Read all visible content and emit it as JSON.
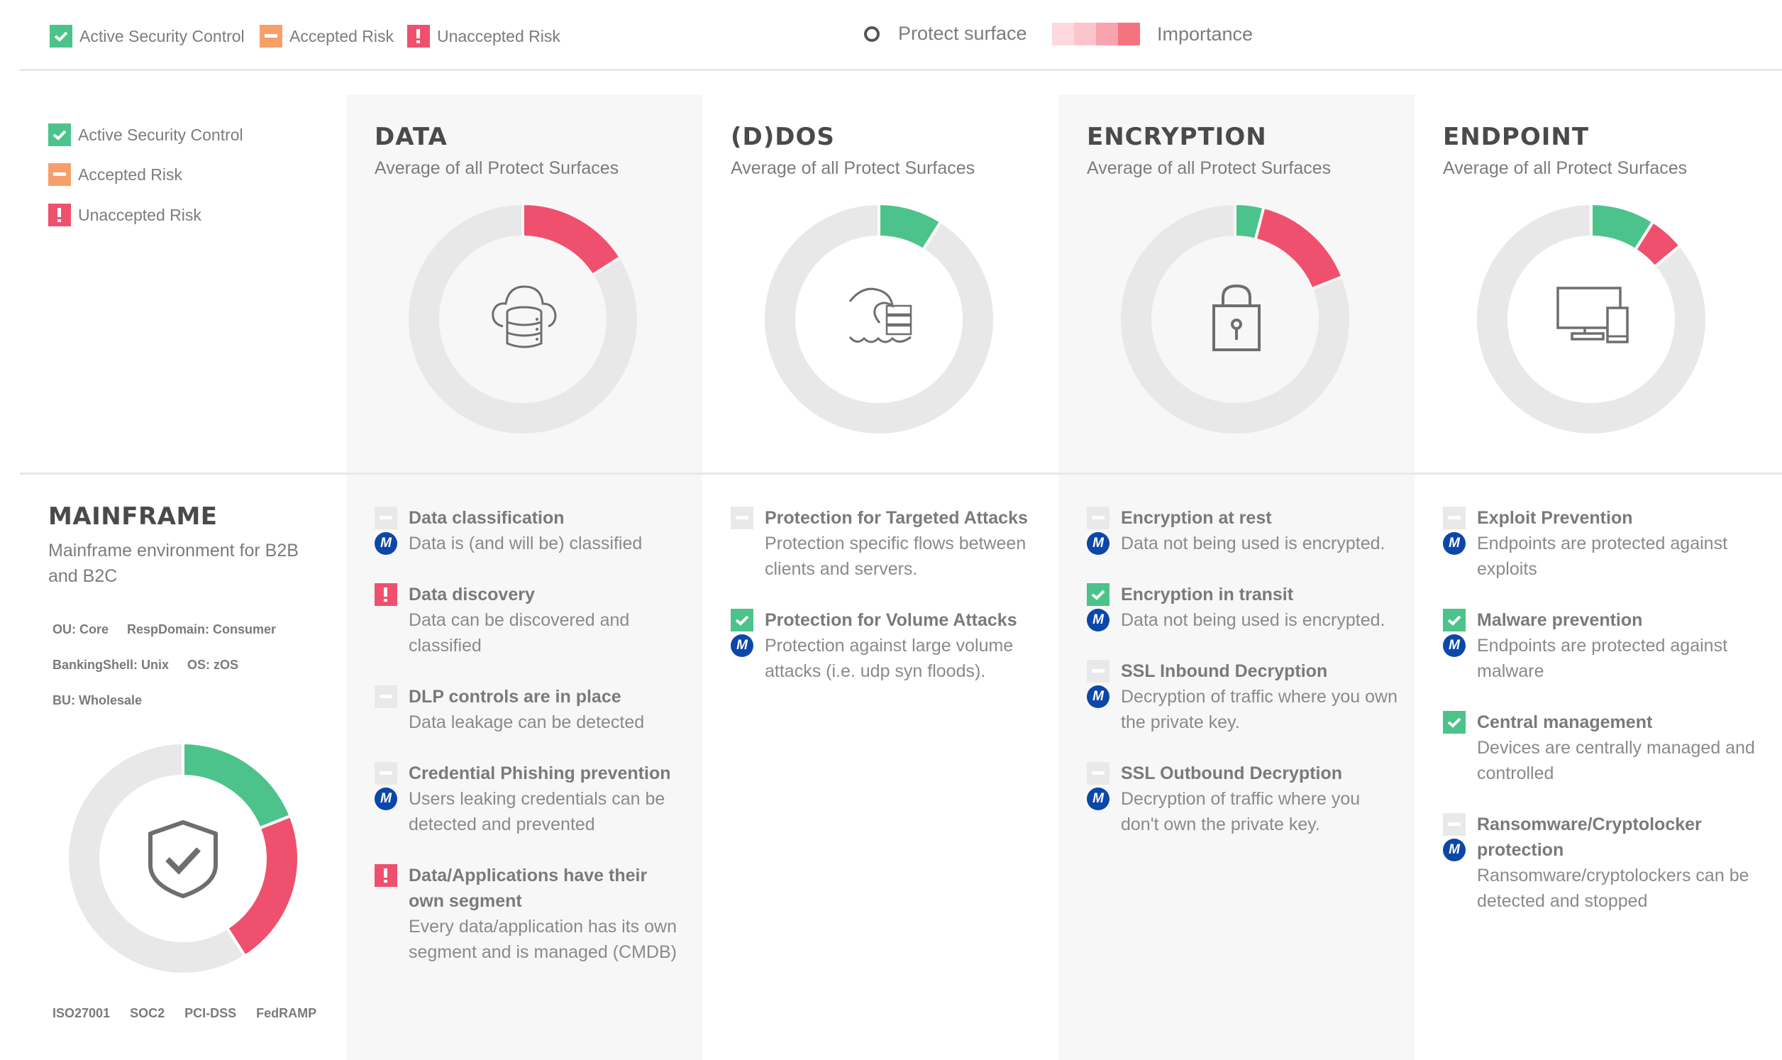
{
  "colors": {
    "green": "#4cc38a",
    "orange": "#f5a06a",
    "red": "#ef506e",
    "gray_track": "#e8e8e8",
    "m_badge": "#0b47a8",
    "importance_scale": [
      "#fdd9de",
      "#fcc4cc",
      "#f9a3ae",
      "#f5737f"
    ]
  },
  "header": {
    "legend": [
      {
        "icon": "check-icon",
        "status": "active",
        "label": "Active Security Control"
      },
      {
        "icon": "minus-icon",
        "status": "accepted",
        "label": "Accepted Risk"
      },
      {
        "icon": "exclamation-icon",
        "status": "unaccepted",
        "label": "Unaccepted Risk"
      }
    ],
    "protect_surface_label": "Protect surface",
    "importance_label": "Importance"
  },
  "side_legend": [
    {
      "icon": "check-icon",
      "status": "active",
      "label": "Active Security Control"
    },
    {
      "icon": "minus-icon",
      "status": "accepted",
      "label": "Accepted Risk"
    },
    {
      "icon": "exclamation-icon",
      "status": "unaccepted",
      "label": "Unaccepted Risk"
    }
  ],
  "mainframe": {
    "title": "MAINFRAME",
    "description": "Mainframe environment for B2B and B2C",
    "tags": [
      "OU: Core",
      "RespDomain: Consumer",
      "BankingShell: Unix",
      "OS: zOS",
      "BU: Wholesale"
    ],
    "certifications": [
      "ISO27001",
      "SOC2",
      "PCI-DSS",
      "FedRAMP"
    ],
    "icon": "shield-check-icon"
  },
  "columns": [
    {
      "title": "DATA",
      "subtitle": "Average of all Protect Surfaces",
      "icon": "cloud-database-icon",
      "controls": [
        {
          "status": "neutral",
          "title": "Data classification",
          "desc": "Data is (and will be) classified",
          "managed": true
        },
        {
          "status": "unaccepted",
          "title": "Data discovery",
          "desc": "Data can be discovered and classified",
          "managed": false
        },
        {
          "status": "neutral",
          "title": "DLP controls are in place",
          "desc": "Data leakage can be detected",
          "managed": false
        },
        {
          "status": "neutral",
          "title": "Credential Phishing prevention",
          "desc": "Users leaking credentials can be detected and prevented",
          "managed": true
        },
        {
          "status": "unaccepted",
          "title": "Data/Applications have their own segment",
          "desc": "Every data/application has its own segment and is managed (CMDB)",
          "managed": false
        }
      ]
    },
    {
      "title": "(D)DOS",
      "subtitle": "Average of all Protect Surfaces",
      "icon": "wave-server-icon",
      "controls": [
        {
          "status": "neutral",
          "title": "Protection for Targeted Attacks",
          "desc": "Protection specific flows between clients and servers.",
          "managed": false
        },
        {
          "status": "active",
          "title": "Protection for Volume Attacks",
          "desc": "Protection against large volume attacks (i.e. udp syn floods).",
          "managed": true
        }
      ]
    },
    {
      "title": "ENCRYPTION",
      "subtitle": "Average of all Protect Surfaces",
      "icon": "padlock-icon",
      "controls": [
        {
          "status": "neutral",
          "title": "Encryption at rest",
          "desc": "Data not being used is encrypted.",
          "managed": true
        },
        {
          "status": "active",
          "title": "Encryption in transit",
          "desc": "Data not being used is encrypted.",
          "managed": true
        },
        {
          "status": "neutral",
          "title": "SSL Inbound Decryption",
          "desc": "Decryption of traffic where you own the private key.",
          "managed": true
        },
        {
          "status": "neutral",
          "title": "SSL Outbound Decryption",
          "desc": "Decryption of traffic where you don't own the private key.",
          "managed": true
        }
      ]
    },
    {
      "title": "ENDPOINT",
      "subtitle": "Average of all Protect Surfaces",
      "icon": "devices-icon",
      "controls": [
        {
          "status": "neutral",
          "title": "Exploit Prevention",
          "desc": "Endpoints are protected against exploits",
          "managed": true
        },
        {
          "status": "active",
          "title": "Malware prevention",
          "desc": "Endpoints are protected against malware",
          "managed": true
        },
        {
          "status": "active",
          "title": "Central management",
          "desc": "Devices are centrally managed and controlled",
          "managed": false
        },
        {
          "status": "neutral",
          "title": "Ransomware/Cryptolocker protection",
          "desc": "Ransomware/cryptolockers can be detected and stopped",
          "managed": true
        }
      ]
    }
  ],
  "chart_data": [
    {
      "type": "pie",
      "title": "DATA",
      "subtitle": "Average of all Protect Surfaces",
      "segments": [
        {
          "name": "Unaccepted Risk",
          "value": 0.16
        },
        {
          "name": "Remaining",
          "value": 0.84
        }
      ]
    },
    {
      "type": "pie",
      "title": "(D)DOS",
      "subtitle": "Average of all Protect Surfaces",
      "segments": [
        {
          "name": "Active Security Control",
          "value": 0.09
        },
        {
          "name": "Remaining",
          "value": 0.91
        }
      ]
    },
    {
      "type": "pie",
      "title": "ENCRYPTION",
      "subtitle": "Average of all Protect Surfaces",
      "segments": [
        {
          "name": "Active Security Control",
          "value": 0.04
        },
        {
          "name": "Unaccepted Risk",
          "value": 0.15
        },
        {
          "name": "Remaining",
          "value": 0.81
        }
      ]
    },
    {
      "type": "pie",
      "title": "ENDPOINT",
      "subtitle": "Average of all Protect Surfaces",
      "segments": [
        {
          "name": "Active Security Control",
          "value": 0.09
        },
        {
          "name": "Unaccepted Risk",
          "value": 0.05
        },
        {
          "name": "Remaining",
          "value": 0.86
        }
      ]
    },
    {
      "type": "pie",
      "title": "MAINFRAME",
      "segments": [
        {
          "name": "Active Security Control",
          "value": 0.19
        },
        {
          "name": "Unaccepted Risk",
          "value": 0.22
        },
        {
          "name": "Remaining",
          "value": 0.59
        }
      ]
    }
  ]
}
